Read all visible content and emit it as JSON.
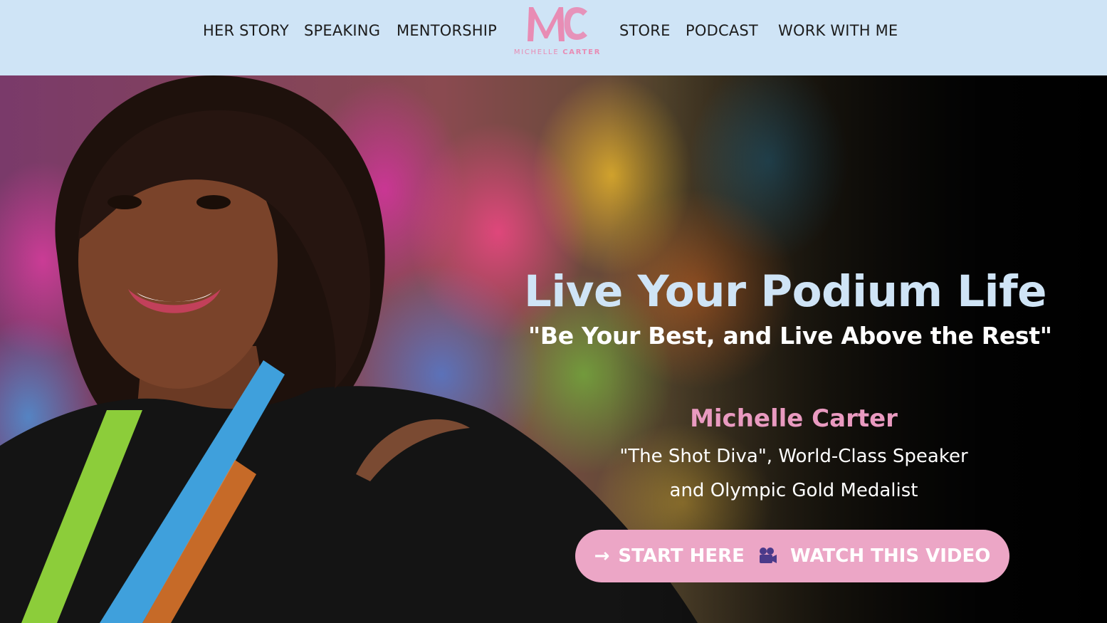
{
  "nav": {
    "left": [
      "HER STORY",
      "SPEAKING",
      "MENTORSHIP"
    ],
    "right": [
      "STORE",
      "PODCAST",
      "WORK WITH ME"
    ]
  },
  "logo": {
    "monogram": "MC",
    "name_first": "MICHELLE",
    "name_last": "CARTER"
  },
  "hero": {
    "title": "Live Your Podium Life",
    "quote": "\"Be Your Best, and Live Above the Rest\"",
    "name": "Michelle Carter",
    "subtitle_line1": "\"The Shot Diva\", World-Class Speaker",
    "subtitle_line2": "and Olympic Gold Medalist",
    "cta": {
      "arrow": "→",
      "label_start": "START HERE",
      "icon": "video-camera-icon",
      "label_end": "WATCH THIS VIDEO"
    }
  },
  "colors": {
    "header_bg": "#cfe4f6",
    "accent_pink": "#e99ac0",
    "cta_bg": "#eca6c6",
    "title_blue": "#cfe4f6"
  }
}
